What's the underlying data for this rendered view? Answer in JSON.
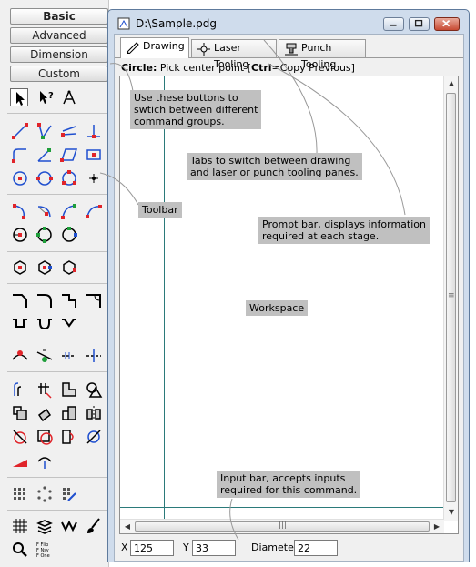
{
  "groups": {
    "basic": "Basic",
    "advanced": "Advanced",
    "dimension": "Dimension",
    "custom": "Custom"
  },
  "window": {
    "title": "D:\\Sample.pdg"
  },
  "tabs": [
    "Drawing",
    "Laser Tooling",
    "Punch Tooling"
  ],
  "prompt": {
    "command": "Circle:",
    "text_before": " Pick center point [",
    "key": "Ctrl",
    "text_after": "=Copy Previous]"
  },
  "input_bar": {
    "x_label": "X",
    "x_value": "125",
    "y_label": "Y",
    "y_value": "33",
    "diameter_label": "Diameter",
    "diameter_value": "22"
  },
  "annotations": {
    "groups": "Use these buttons to\nswtich between different\ncommand groups.",
    "tabs": "Tabs to switch between drawing\nand laser or punch tooling panes.",
    "toolbar": "Toolbar",
    "prompt": "Prompt bar, displays information\nrequired at each stage.",
    "workspace": "Workspace",
    "input": "Input bar, accepts inputs\nrequired for this command."
  },
  "colors": {
    "accent_red": "#e0242a",
    "accent_blue": "#1f4fcf",
    "accent_green": "#1e9e3a",
    "crosshair": "#2b7a7a"
  }
}
